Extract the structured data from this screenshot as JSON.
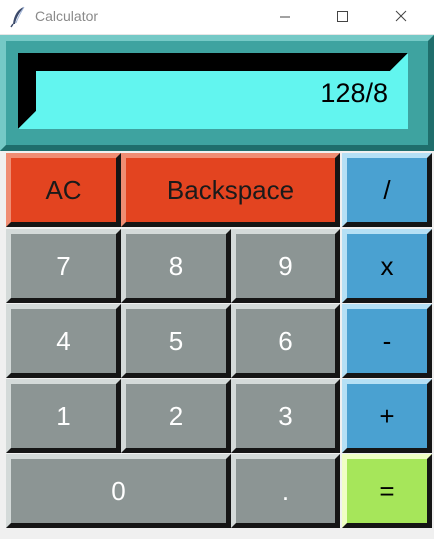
{
  "window": {
    "title": "Calculator",
    "controls": {
      "minimize": "—",
      "maximize": "☐",
      "close": "✕"
    }
  },
  "display": {
    "value": "128/8"
  },
  "keys": {
    "clear": "AC",
    "backspace": "Backspace",
    "divide": "/",
    "seven": "7",
    "eight": "8",
    "nine": "9",
    "multiply": "x",
    "four": "4",
    "five": "5",
    "six": "6",
    "subtract": "-",
    "one": "1",
    "two": "2",
    "three": "3",
    "add": "+",
    "zero": "0",
    "decimal": ".",
    "equals": "="
  },
  "colors": {
    "display_frame": "#3ea3a0",
    "display_screen": "#62f5ef",
    "clear_keys": "#e34420",
    "digit_keys": "#8c9594",
    "operator_keys": "#4aa1d1",
    "equals_key": "#a6e65a"
  }
}
